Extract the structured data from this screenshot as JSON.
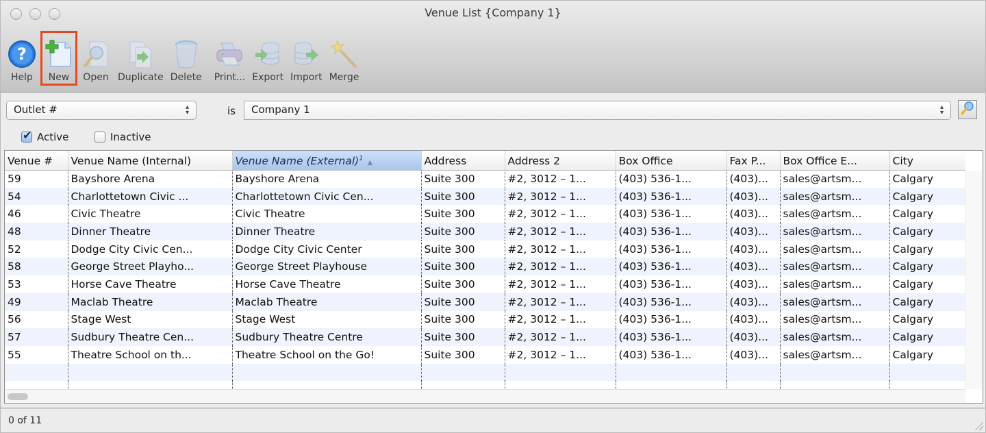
{
  "window": {
    "title": "Venue List {Company 1}"
  },
  "toolbar": {
    "items": [
      {
        "id": "help",
        "label": "Help",
        "icon": "help-icon"
      },
      {
        "id": "new",
        "label": "New",
        "icon": "new-document-icon",
        "highlighted": true
      },
      {
        "id": "open",
        "label": "Open",
        "icon": "open-magnifier-icon"
      },
      {
        "id": "duplicate",
        "label": "Duplicate",
        "icon": "duplicate-icon"
      },
      {
        "id": "delete",
        "label": "Delete",
        "icon": "trash-icon"
      },
      {
        "id": "print",
        "label": "Print...",
        "icon": "printer-icon"
      },
      {
        "id": "export",
        "label": "Export",
        "icon": "export-database-icon"
      },
      {
        "id": "import",
        "label": "Import",
        "icon": "import-database-icon"
      },
      {
        "id": "merge",
        "label": "Merge",
        "icon": "magic-wand-icon"
      }
    ],
    "highlight_color": "#e04b25"
  },
  "filter": {
    "field": "Outlet #",
    "operator": "is",
    "value": "Company 1",
    "search_icon": "magnifier-icon"
  },
  "checkboxes": [
    {
      "label": "Active",
      "checked": true
    },
    {
      "label": "Inactive",
      "checked": false
    }
  ],
  "table": {
    "columns": [
      {
        "label": "Venue #"
      },
      {
        "label": "Venue Name (Internal)"
      },
      {
        "label": "Venue Name (External)",
        "sort_index": "1",
        "sorted": "ascending"
      },
      {
        "label": "Address"
      },
      {
        "label": "Address 2"
      },
      {
        "label": "Box Office"
      },
      {
        "label": "Fax P..."
      },
      {
        "label": "Box Office E..."
      },
      {
        "label": "City"
      }
    ],
    "rows": [
      [
        "59",
        "Bayshore Arena",
        "Bayshore Arena",
        "Suite 300",
        "#2, 3012 – 1...",
        "(403) 536-1...",
        "(403)...",
        "sales@artsm...",
        "Calgary"
      ],
      [
        "54",
        "Charlottetown Civic ...",
        "Charlottetown Civic Cen...",
        "Suite 300",
        "#2, 3012 – 1...",
        "(403) 536-1...",
        "(403)...",
        "sales@artsm...",
        "Calgary"
      ],
      [
        "46",
        "Civic Theatre",
        "Civic Theatre",
        "Suite 300",
        "#2, 3012 – 1...",
        "(403) 536-1...",
        "(403)...",
        "sales@artsm...",
        "Calgary"
      ],
      [
        "48",
        "Dinner Theatre",
        "Dinner Theatre",
        "Suite 300",
        "#2, 3012 – 1...",
        "(403) 536-1...",
        "(403)...",
        "sales@artsm...",
        "Calgary"
      ],
      [
        "52",
        "Dodge City Civic Cen...",
        "Dodge City Civic Center",
        "Suite 300",
        "#2, 3012 – 1...",
        "(403) 536-1...",
        "(403)...",
        "sales@artsm...",
        "Calgary"
      ],
      [
        "58",
        "George Street Playho...",
        "George Street Playhouse",
        "Suite 300",
        "#2, 3012 – 1...",
        "(403) 536-1...",
        "(403)...",
        "sales@artsm...",
        "Calgary"
      ],
      [
        "53",
        "Horse Cave Theatre",
        "Horse Cave Theatre",
        "Suite 300",
        "#2, 3012 – 1...",
        "(403) 536-1...",
        "(403)...",
        "sales@artsm...",
        "Calgary"
      ],
      [
        "49",
        "Maclab Theatre",
        "Maclab Theatre",
        "Suite 300",
        "#2, 3012 – 1...",
        "(403) 536-1...",
        "(403)...",
        "sales@artsm...",
        "Calgary"
      ],
      [
        "56",
        "Stage West",
        "Stage West",
        "Suite 300",
        "#2, 3012 – 1...",
        "(403) 536-1...",
        "(403)...",
        "sales@artsm...",
        "Calgary"
      ],
      [
        "57",
        "Sudbury Theatre Cen...",
        "Sudbury Theatre Centre",
        "Suite 300",
        "#2, 3012 – 1...",
        "(403) 536-1...",
        "(403)...",
        "sales@artsm...",
        "Calgary"
      ],
      [
        "55",
        "Theatre School on th...",
        "Theatre School on the Go!",
        "Suite 300",
        "#2, 3012 – 1...",
        "(403) 536-1...",
        "(403)...",
        "sales@artsm...",
        "Calgary"
      ]
    ]
  },
  "status": {
    "text": "0 of 11"
  }
}
